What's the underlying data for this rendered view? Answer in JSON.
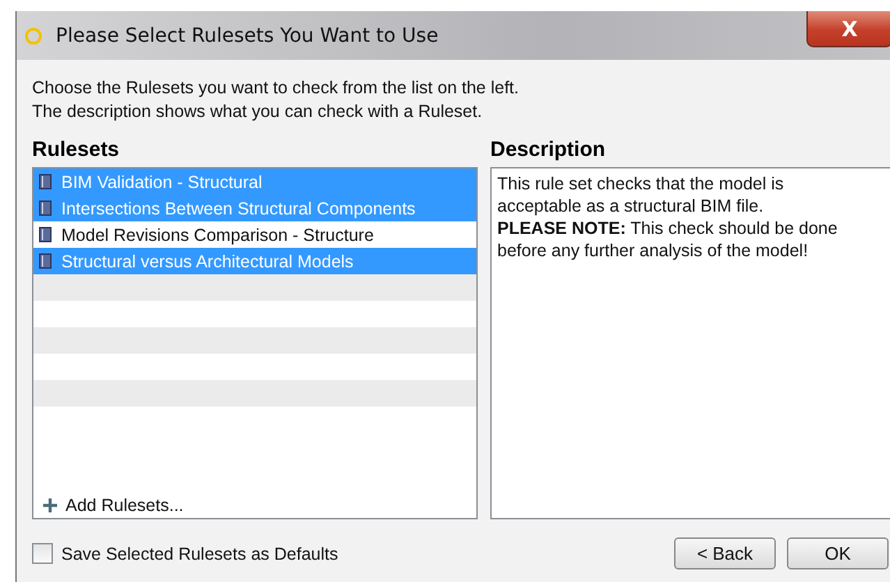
{
  "window": {
    "title": "Please Select Rulesets You Want to Use",
    "close": "X"
  },
  "instructions": [
    "Choose the Rulesets you want to check from the list on the left.",
    "The description shows what you can check with a Ruleset."
  ],
  "rulesets": {
    "heading": "Rulesets",
    "items": [
      {
        "label": "BIM Validation - Structural",
        "selected": true
      },
      {
        "label": "Intersections Between Structural Components",
        "selected": true
      },
      {
        "label": "Model Revisions Comparison - Structure",
        "selected": false
      },
      {
        "label": "Structural versus Architectural Models",
        "selected": true
      }
    ],
    "add": "Add Rulesets..."
  },
  "description": {
    "heading": "Description",
    "lines": [
      "This rule set checks that the model is",
      "acceptable as a structural BIM file.",
      "**PLEASE NOTE:** This check should be done",
      "before any further analysis of the model!"
    ]
  },
  "save_defaults": {
    "label": "Save Selected Rulesets as Defaults",
    "checked": false
  },
  "buttons": [
    "< Back",
    "OK"
  ]
}
